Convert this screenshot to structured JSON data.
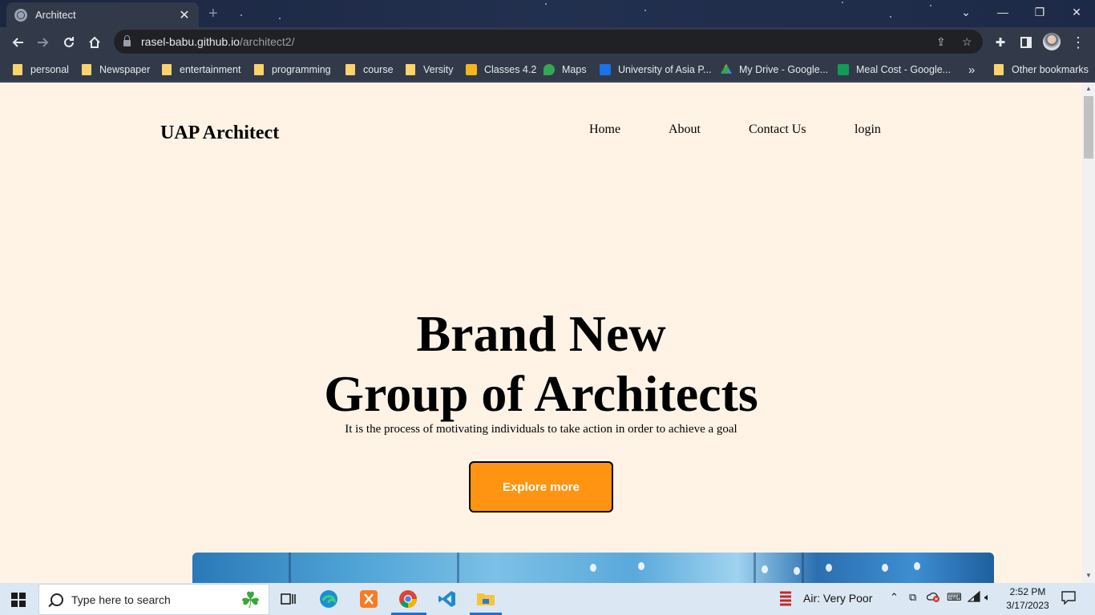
{
  "browser": {
    "tab_title": "Architect",
    "tab_close": "✕",
    "new_tab": "+",
    "url_host": "rasel-babu.github.io",
    "url_path": "/architect2/",
    "minimize": "—",
    "restore": "❐",
    "close": "✕",
    "tab_search": "⌄"
  },
  "bookmarks": [
    {
      "label": "personal",
      "icon": "folder-icon"
    },
    {
      "label": "Newspaper",
      "icon": "folder-icon"
    },
    {
      "label": "entertainment",
      "icon": "folder-icon"
    },
    {
      "label": "programming",
      "icon": "folder-icon"
    },
    {
      "label": "course",
      "icon": "folder-icon"
    },
    {
      "label": "Versity",
      "icon": "folder-icon"
    },
    {
      "label": "Classes 4.2",
      "icon": "classroom-icon",
      "color": "#f2b51c"
    },
    {
      "label": "Maps",
      "icon": "maps-icon",
      "color": "#34a853"
    },
    {
      "label": "University of Asia P...",
      "icon": "uap-icon",
      "color": "#1a73e8"
    },
    {
      "label": "My Drive - Google...",
      "icon": "drive-icon",
      "color": "#fbbc04"
    },
    {
      "label": "Meal Cost - Google...",
      "icon": "sheets-icon",
      "color": "#0f9d58"
    }
  ],
  "bookmarks_overflow": "»",
  "other_bookmarks": "Other bookmarks",
  "site": {
    "brand": "UAP Architect",
    "nav": [
      "Home",
      "About",
      "Contact Us",
      "login"
    ],
    "hero_line1": "Brand New",
    "hero_line2": "Group of Architects",
    "hero_sub": "It is the process of motivating individuals to take action in order to achieve a goal",
    "cta": "Explore more",
    "accent": "#ff9412",
    "background": "#fff3e6"
  },
  "taskbar": {
    "search_placeholder": "Type here to search",
    "air_quality": "Air: Very Poor",
    "time": "2:52 PM",
    "date": "3/17/2023"
  }
}
